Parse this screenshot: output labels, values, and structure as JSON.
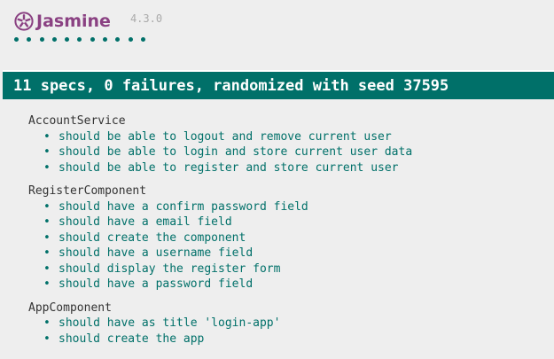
{
  "header": {
    "logo_text": "Jasmine",
    "version": "4.3.0",
    "logo_color": "#8a4182",
    "icon": "jasmine-flower-icon"
  },
  "progress": {
    "dot_color": "#007069",
    "specs_run": 11
  },
  "summary": {
    "text": "11 specs, 0 failures, randomized with seed 37595",
    "bar_color": "#007069"
  },
  "suites": [
    {
      "name": "AccountService",
      "specs": [
        "should be able to logout and remove current user",
        "should be able to login and store current user data",
        "should be able to register and store current user"
      ]
    },
    {
      "name": "RegisterComponent",
      "specs": [
        "should have a confirm password field",
        "should have a email field",
        "should create the component",
        "should have a username field",
        "should display the register form",
        "should have a password field"
      ]
    },
    {
      "name": "AppComponent",
      "specs": [
        "should have as title 'login-app'",
        "should create the app"
      ]
    }
  ]
}
